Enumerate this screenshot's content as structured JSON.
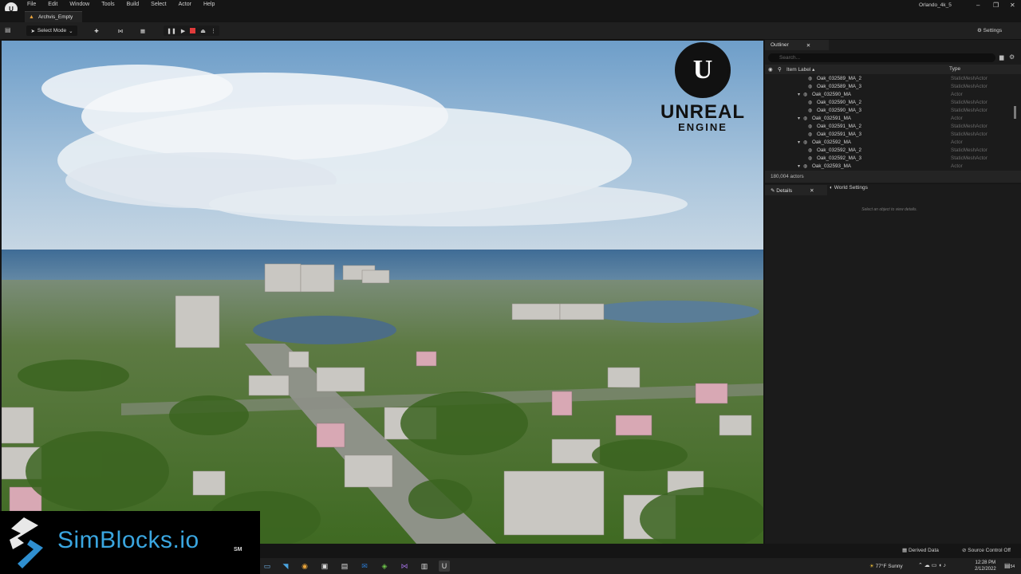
{
  "app": {
    "menus": [
      "File",
      "Edit",
      "Window",
      "Tools",
      "Build",
      "Select",
      "Actor",
      "Help"
    ],
    "project_name": "Orlando_4k_5",
    "tab_label": "Archvis_Empty"
  },
  "toolbar": {
    "select_mode": "Select Mode",
    "settings": "Settings"
  },
  "viewport": {
    "logo_word1": "UNREAL",
    "logo_word2": "ENGINE"
  },
  "watermark": {
    "brand": "SimBlocks.io",
    "mark": "SM"
  },
  "outliner": {
    "tab_label": "Outliner",
    "search_placeholder": "Search...",
    "col_item_label": "Item Label",
    "col_type": "Type",
    "rows": [
      {
        "label": "Oak_032589_MA_2",
        "type": "StaticMeshActor",
        "parent": false
      },
      {
        "label": "Oak_032589_MA_3",
        "type": "StaticMeshActor",
        "parent": false
      },
      {
        "label": "Oak_032590_MA",
        "type": "Actor",
        "parent": true
      },
      {
        "label": "Oak_032590_MA_2",
        "type": "StaticMeshActor",
        "parent": false
      },
      {
        "label": "Oak_032590_MA_3",
        "type": "StaticMeshActor",
        "parent": false
      },
      {
        "label": "Oak_032591_MA",
        "type": "Actor",
        "parent": true
      },
      {
        "label": "Oak_032591_MA_2",
        "type": "StaticMeshActor",
        "parent": false
      },
      {
        "label": "Oak_032591_MA_3",
        "type": "StaticMeshActor",
        "parent": false
      },
      {
        "label": "Oak_032592_MA",
        "type": "Actor",
        "parent": true
      },
      {
        "label": "Oak_032592_MA_2",
        "type": "StaticMeshActor",
        "parent": false
      },
      {
        "label": "Oak_032592_MA_3",
        "type": "StaticMeshActor",
        "parent": false
      },
      {
        "label": "Oak_032593_MA",
        "type": "Actor",
        "parent": true
      }
    ],
    "actor_count": "180,004 actors"
  },
  "details": {
    "tab_label": "Details",
    "world_settings": "World Settings",
    "empty_message": "Select an object to view details."
  },
  "statusbar": {
    "derived_data": "Derived Data",
    "source_control": "Source Control Off"
  },
  "taskbar": {
    "weather": "77°F  Sunny",
    "time": "12:28 PM",
    "date": "2/12/2022",
    "notifications": "54"
  }
}
